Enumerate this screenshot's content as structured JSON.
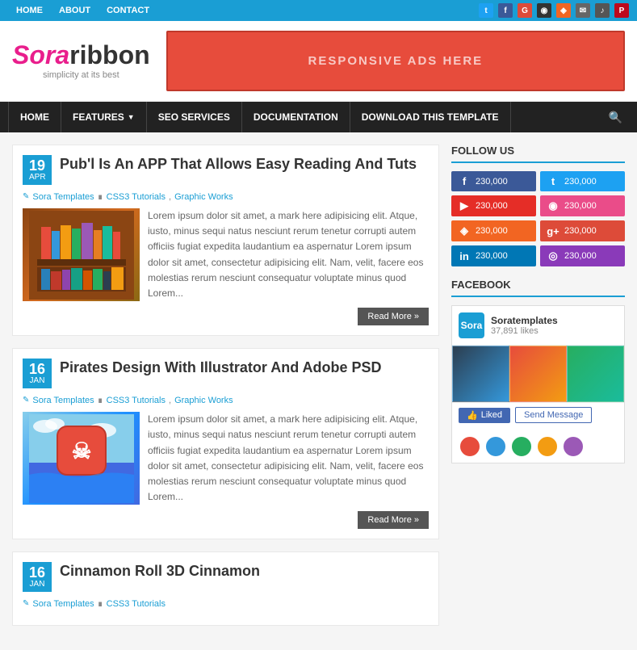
{
  "topbar": {
    "nav": [
      {
        "label": "HOME",
        "id": "top-home"
      },
      {
        "label": "ABOUT",
        "id": "top-about"
      },
      {
        "label": "CONTACT",
        "id": "top-contact"
      }
    ],
    "social_icons": [
      {
        "name": "twitter",
        "symbol": "t",
        "color": "#1da1f2"
      },
      {
        "name": "facebook",
        "symbol": "f",
        "color": "#3b5998"
      },
      {
        "name": "google-plus",
        "symbol": "G+",
        "color": "#dd4b39"
      },
      {
        "name": "instagram",
        "symbol": "in",
        "color": "#8a3ab9"
      },
      {
        "name": "rss",
        "symbol": "⌂",
        "color": "#f26522"
      },
      {
        "name": "mail",
        "symbol": "✉",
        "color": "#666"
      },
      {
        "name": "sound",
        "symbol": "♪",
        "color": "#333"
      },
      {
        "name": "pinterest",
        "symbol": "P",
        "color": "#bd081c"
      }
    ]
  },
  "header": {
    "logo_sora": "Sora",
    "logo_ribbon": "ribbon",
    "tagline": "simplicity at its best",
    "ad_text": "RESPONSIVE ADS HERE"
  },
  "nav": {
    "items": [
      {
        "label": "HOME",
        "id": "nav-home"
      },
      {
        "label": "FEATURES",
        "id": "nav-features",
        "has_dropdown": true
      },
      {
        "label": "SEO SERVICES",
        "id": "nav-seo"
      },
      {
        "label": "DOCUMENTATION",
        "id": "nav-docs"
      },
      {
        "label": "DOWNLOAD THIS TEMPLATE",
        "id": "nav-download"
      }
    ]
  },
  "posts": [
    {
      "day": "19",
      "month": "APR",
      "title": "Pub'l Is An APP That Allows Easy Reading And Tuts",
      "author": "Sora Templates",
      "cats": [
        "CSS3 Tutorials",
        "Graphic Works"
      ],
      "excerpt": "Lorem ipsum dolor sit amet, a mark here adipisicing elit. Atque, iusto, minus sequi natus nesciunt rerum tenetur corrupti autem officiis fugiat expedita laudantium ea aspernatur Lorem ipsum dolor sit amet, consectetur adipisicing elit. Nam, velit, facere eos molestias rerum nesciunt consequatur voluptate minus quod Lorem...",
      "read_more": "Read More »",
      "thumb_type": "books"
    },
    {
      "day": "16",
      "month": "JAN",
      "title": "Pirates Design With Illustrator And Adobe PSD",
      "author": "Sora Templates",
      "cats": [
        "CSS3 Tutorials",
        "Graphic Works"
      ],
      "excerpt": "Lorem ipsum dolor sit amet, a mark here adipisicing elit. Atque, iusto, minus sequi natus nesciunt rerum tenetur corrupti autem officiis fugiat expedita laudantium ea aspernatur Lorem ipsum dolor sit amet, consectetur adipisicing elit. Nam, velit, facere eos molestias rerum nesciunt consequatur voluptate minus quod Lorem...",
      "read_more": "Read More »",
      "thumb_type": "pirate"
    },
    {
      "day": "16",
      "month": "JAN",
      "title": "Cinnamon Roll 3D Cinnamon",
      "author": "Sora Templates",
      "cats": [
        "CSS3 Tutorials"
      ],
      "excerpt": "",
      "read_more": "",
      "thumb_type": "cinnamon"
    }
  ],
  "sidebar": {
    "follow_title": "FOLLOW US",
    "social_btns": [
      {
        "label": "facebook",
        "symbol": "f",
        "count": "230,000",
        "class": "fb-btn"
      },
      {
        "label": "twitter",
        "symbol": "t",
        "count": "230,000",
        "class": "tw-btn"
      },
      {
        "label": "youtube",
        "symbol": "▶",
        "count": "230,000",
        "class": "yt-btn"
      },
      {
        "label": "dribbble",
        "symbol": "◉",
        "count": "230,000",
        "class": "dr-btn"
      },
      {
        "label": "rss",
        "symbol": "◈",
        "count": "230,000",
        "class": "rss-btn"
      },
      {
        "label": "google-plus",
        "symbol": "g+",
        "count": "230,000",
        "class": "gp-btn"
      },
      {
        "label": "linkedin",
        "symbol": "in",
        "count": "230,000",
        "class": "li-btn"
      },
      {
        "label": "instagram",
        "symbol": "◎",
        "count": "230,000",
        "class": "ig-btn"
      }
    ],
    "facebook_title": "FACEBOOK",
    "fb_page_name": "Soratemplates",
    "fb_likes": "37,891 likes",
    "fb_avatar_text": "Sora",
    "fb_like_label": "Liked",
    "fb_msg_label": "Send Message"
  }
}
